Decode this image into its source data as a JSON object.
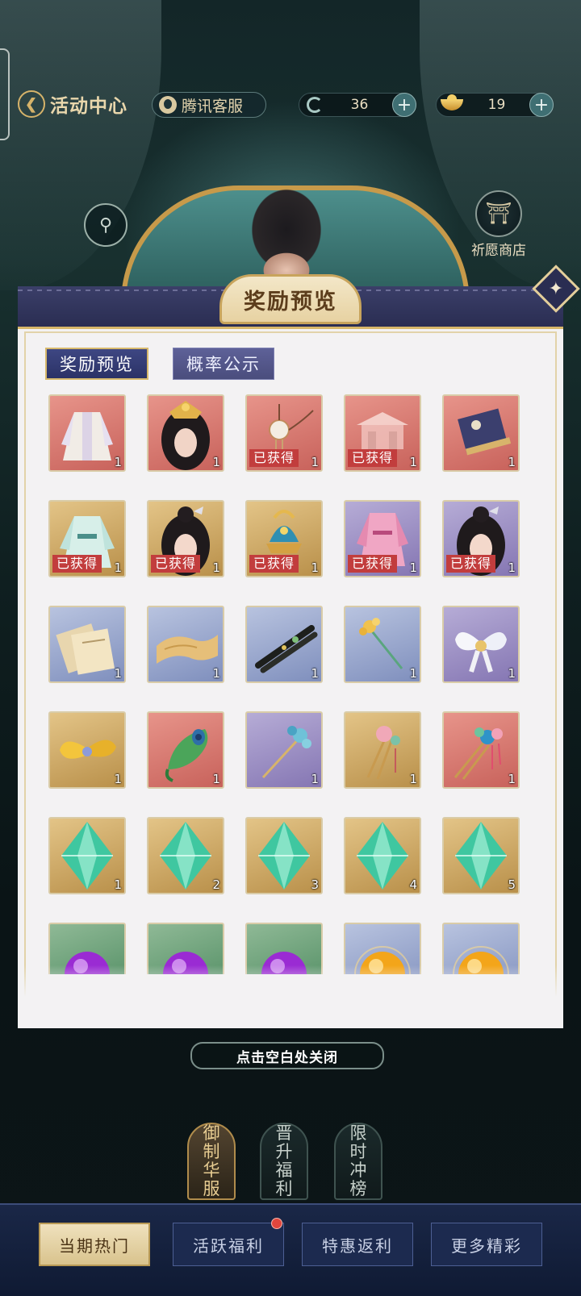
{
  "topbar": {
    "back_label": "活动中心",
    "service_label": "腾讯客服",
    "currency_1_value": "36",
    "currency_2_value": "19",
    "plus_symbol": "+"
  },
  "side": {
    "shop_label": "祈愿商店"
  },
  "modal": {
    "title": "奖励预览",
    "tabs": [
      {
        "label": "奖励预览",
        "active": true
      },
      {
        "label": "概率公示",
        "active": false
      }
    ],
    "owned_label": "已获得",
    "items": [
      {
        "bg": "red",
        "art": "robe",
        "count": "1",
        "owned": false
      },
      {
        "bg": "red",
        "art": "head-gold",
        "count": "1",
        "owned": false
      },
      {
        "bg": "red",
        "art": "pendant",
        "count": "1",
        "owned": true
      },
      {
        "bg": "red",
        "art": "pavilion",
        "count": "1",
        "owned": true
      },
      {
        "bg": "red",
        "art": "scroll",
        "count": "1",
        "owned": false
      },
      {
        "bg": "gold",
        "art": "robe-teal",
        "count": "1",
        "owned": true
      },
      {
        "bg": "gold",
        "art": "head-dark",
        "count": "1",
        "owned": true
      },
      {
        "bg": "gold",
        "art": "crown",
        "count": "1",
        "owned": true
      },
      {
        "bg": "purple",
        "art": "robe-pink",
        "count": "1",
        "owned": true
      },
      {
        "bg": "purple",
        "art": "head-dark",
        "count": "1",
        "owned": true
      },
      {
        "bg": "blue",
        "art": "books",
        "count": "1",
        "owned": false
      },
      {
        "bg": "blue",
        "art": "paper",
        "count": "1",
        "owned": false
      },
      {
        "bg": "blue",
        "art": "chopsticks",
        "count": "1",
        "owned": false
      },
      {
        "bg": "blue",
        "art": "flower-pin",
        "count": "1",
        "owned": false
      },
      {
        "bg": "purple",
        "art": "ribbon-white",
        "count": "1",
        "owned": false
      },
      {
        "bg": "gold",
        "art": "ribbon-gold",
        "count": "1",
        "owned": false
      },
      {
        "bg": "red",
        "art": "peacock",
        "count": "1",
        "owned": false
      },
      {
        "bg": "purple",
        "art": "hairpin-blue",
        "count": "1",
        "owned": false
      },
      {
        "bg": "gold",
        "art": "hairpin-pink",
        "count": "1",
        "owned": false
      },
      {
        "bg": "red",
        "art": "hairpin-colorful",
        "count": "1",
        "owned": false
      },
      {
        "bg": "gold",
        "art": "crystal",
        "count": "1",
        "owned": false
      },
      {
        "bg": "gold",
        "art": "crystal",
        "count": "2",
        "owned": false
      },
      {
        "bg": "gold",
        "art": "crystal",
        "count": "3",
        "owned": false
      },
      {
        "bg": "gold",
        "art": "crystal",
        "count": "4",
        "owned": false
      },
      {
        "bg": "gold",
        "art": "crystal",
        "count": "5",
        "owned": false
      },
      {
        "bg": "green",
        "art": "orb-purple",
        "count": "",
        "owned": false
      },
      {
        "bg": "green",
        "art": "orb-purple",
        "count": "",
        "owned": false
      },
      {
        "bg": "green",
        "art": "orb-purple",
        "count": "",
        "owned": false
      },
      {
        "bg": "blue",
        "art": "orb-gold",
        "count": "",
        "owned": false
      },
      {
        "bg": "blue",
        "art": "orb-gold",
        "count": "",
        "owned": false
      }
    ]
  },
  "close_hint": "点击空白处关闭",
  "side_tabs": [
    {
      "label": "御制华服",
      "active": true
    },
    {
      "label": "晋升福利",
      "active": false
    },
    {
      "label": "限时冲榜",
      "active": false
    }
  ],
  "bottom_nav": [
    {
      "label": "当期热门",
      "active": true
    },
    {
      "label": "活跃福利",
      "active": false
    },
    {
      "label": "特惠返利",
      "active": false
    },
    {
      "label": "更多精彩",
      "active": false
    }
  ]
}
